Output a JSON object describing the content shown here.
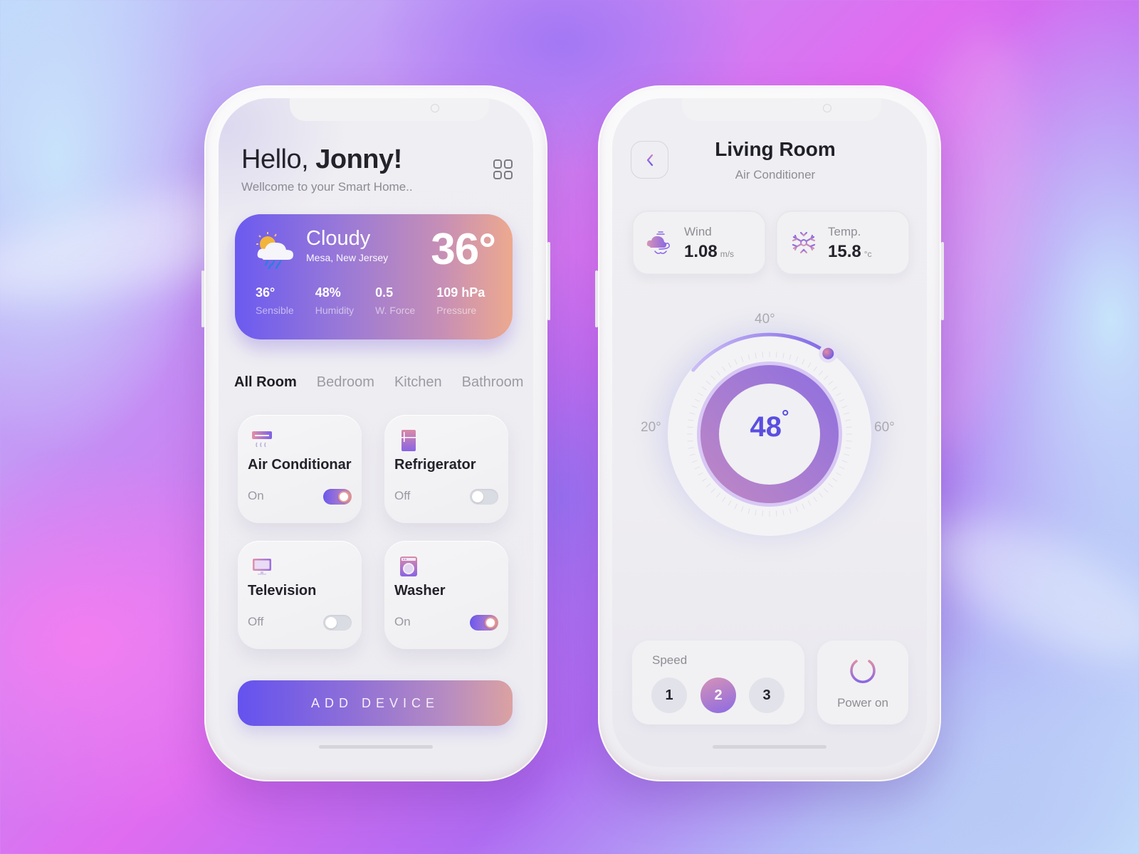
{
  "home": {
    "greeting_prefix": "Hello,",
    "user_name": "Jonny!",
    "welcome": "Wellcome to your Smart Home..",
    "menu_icon": "grid-icon",
    "weather": {
      "icon": "cloud-rain-sun-icon",
      "condition": "Cloudy",
      "location": "Mesa, New Jersey",
      "temperature": "36°",
      "stats": [
        {
          "value": "36°",
          "label": "Sensible"
        },
        {
          "value": "48%",
          "label": "Humidity"
        },
        {
          "value": "0.5",
          "label": "W. Force"
        },
        {
          "value": "109 hPa",
          "label": "Pressure"
        }
      ]
    },
    "room_tabs": [
      {
        "label": "All Room",
        "active": true
      },
      {
        "label": "Bedroom",
        "active": false
      },
      {
        "label": "Kitchen",
        "active": false
      },
      {
        "label": "Bathroom",
        "active": false
      }
    ],
    "devices": [
      {
        "name": "Air Conditionar",
        "state": "On",
        "on": true,
        "icon": "air-conditioner-icon"
      },
      {
        "name": "Refrigerator",
        "state": "Off",
        "on": false,
        "icon": "refrigerator-icon"
      },
      {
        "name": "Television",
        "state": "Off",
        "on": false,
        "icon": "television-icon"
      },
      {
        "name": "Washer",
        "state": "On",
        "on": true,
        "icon": "washer-icon"
      }
    ],
    "add_device_label": "ADD DEVICE"
  },
  "detail": {
    "back_icon": "chevron-left-icon",
    "title": "Living Room",
    "subtitle": "Air Conditioner",
    "wind": {
      "label": "Wind",
      "value": "1.08",
      "unit": "m/s",
      "icon": "wind-cloud-icon"
    },
    "temp": {
      "label": "Temp.",
      "value": "15.8",
      "unit": "°c",
      "icon": "snowflake-icon"
    },
    "dial": {
      "current": "48",
      "degree_symbol": "°",
      "scale_labels": {
        "min": "20°",
        "mid": "40°",
        "max": "60°"
      },
      "min_value": 20,
      "max_value": 60,
      "set_value": 48
    },
    "speed": {
      "label": "Speed",
      "options": [
        "1",
        "2",
        "3"
      ],
      "selected": "2"
    },
    "power": {
      "label": "Power on",
      "icon": "power-icon"
    }
  },
  "colors": {
    "accent_start": "#6452ef",
    "accent_end": "#e9a690",
    "text_dark": "#23222a",
    "text_muted": "#8e8d94"
  }
}
